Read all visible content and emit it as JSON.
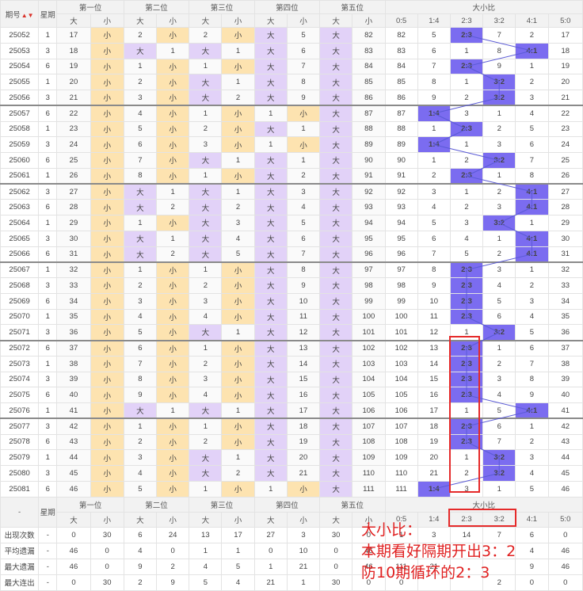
{
  "header": {
    "issue_label": "期号",
    "sort_icon": "▲▼",
    "weekday_label": "星期",
    "positions": [
      "第一位",
      "第二位",
      "第三位",
      "第四位",
      "第五位"
    ],
    "big": "大",
    "small": "小",
    "ratio_title": "大小比",
    "ratios": [
      "0:5",
      "1:4",
      "2:3",
      "3:2",
      "4:1",
      "5:0"
    ]
  },
  "rows": [
    {
      "issue": "25052",
      "wd": "1",
      "p": [
        [
          "17",
          "y"
        ],
        [
          "2",
          "y"
        ],
        [
          "2",
          "y"
        ],
        [
          "大",
          "5"
        ],
        [
          "大",
          "82"
        ]
      ],
      "big": "82",
      "r": [
        "82",
        "5",
        "2:3",
        "7",
        "2",
        "17"
      ],
      "sel": 2
    },
    {
      "issue": "25053",
      "wd": "3",
      "p": [
        [
          "18",
          "y"
        ],
        [
          "大",
          "1"
        ],
        [
          "大",
          "1"
        ],
        [
          "大",
          "6"
        ],
        [
          "大",
          "83"
        ]
      ],
      "big": "83",
      "r": [
        "83",
        "6",
        "1",
        "8",
        "4:1",
        "18"
      ],
      "sel": 4
    },
    {
      "issue": "25054",
      "wd": "6",
      "p": [
        [
          "19",
          "y"
        ],
        [
          "1",
          "y"
        ],
        [
          "1",
          "y"
        ],
        [
          "大",
          "7"
        ],
        [
          "大",
          "84"
        ]
      ],
      "big": "84",
      "r": [
        "84",
        "7",
        "2:3",
        "9",
        "1",
        "19"
      ],
      "sel": 2
    },
    {
      "issue": "25055",
      "wd": "1",
      "p": [
        [
          "20",
          "y"
        ],
        [
          "2",
          "y"
        ],
        [
          "大",
          "1"
        ],
        [
          "大",
          "8"
        ],
        [
          "大",
          "85"
        ]
      ],
      "big": "85",
      "r": [
        "85",
        "8",
        "1",
        "3:2",
        "2",
        "20"
      ],
      "sel": 3
    },
    {
      "issue": "25056",
      "wd": "3",
      "p": [
        [
          "21",
          "y"
        ],
        [
          "3",
          "y"
        ],
        [
          "大",
          "2"
        ],
        [
          "大",
          "9"
        ],
        [
          "大",
          "86"
        ]
      ],
      "big": "86",
      "r": [
        "86",
        "9",
        "2",
        "3:2",
        "3",
        "21"
      ],
      "sel": 3
    },
    {
      "issue": "25057",
      "wd": "6",
      "p": [
        [
          "22",
          "y"
        ],
        [
          "4",
          "y"
        ],
        [
          "1",
          "y"
        ],
        [
          "1",
          "y"
        ],
        [
          "大",
          "87"
        ]
      ],
      "big": "87",
      "r": [
        "87",
        "1:4",
        "3",
        "1",
        "4",
        "22"
      ],
      "sel": 1
    },
    {
      "issue": "25058",
      "wd": "1",
      "p": [
        [
          "23",
          "y"
        ],
        [
          "5",
          "y"
        ],
        [
          "2",
          "y"
        ],
        [
          "大",
          "1"
        ],
        [
          "大",
          "88"
        ]
      ],
      "big": "88",
      "r": [
        "88",
        "1",
        "2:3",
        "2",
        "5",
        "23"
      ],
      "sel": 2
    },
    {
      "issue": "25059",
      "wd": "3",
      "p": [
        [
          "24",
          "y"
        ],
        [
          "6",
          "y"
        ],
        [
          "3",
          "y"
        ],
        [
          "1",
          "y"
        ],
        [
          "大",
          "89"
        ]
      ],
      "big": "89",
      "r": [
        "89",
        "1:4",
        "1",
        "3",
        "6",
        "24"
      ],
      "sel": 1
    },
    {
      "issue": "25060",
      "wd": "6",
      "p": [
        [
          "25",
          "y"
        ],
        [
          "7",
          "y"
        ],
        [
          "大",
          "1"
        ],
        [
          "大",
          "1"
        ],
        [
          "大",
          "90"
        ]
      ],
      "big": "90",
      "r": [
        "90",
        "1",
        "2",
        "3:2",
        "7",
        "25"
      ],
      "sel": 3
    },
    {
      "issue": "25061",
      "wd": "1",
      "p": [
        [
          "26",
          "y"
        ],
        [
          "8",
          "y"
        ],
        [
          "1",
          "y"
        ],
        [
          "大",
          "2"
        ],
        [
          "大",
          "91"
        ]
      ],
      "big": "91",
      "r": [
        "91",
        "2",
        "2:3",
        "1",
        "8",
        "26"
      ],
      "sel": 2
    },
    {
      "issue": "25062",
      "wd": "3",
      "p": [
        [
          "27",
          "y"
        ],
        [
          "大",
          "1"
        ],
        [
          "大",
          "1"
        ],
        [
          "大",
          "3"
        ],
        [
          "大",
          "92"
        ]
      ],
      "big": "92",
      "r": [
        "92",
        "3",
        "1",
        "2",
        "4:1",
        "27"
      ],
      "sel": 4
    },
    {
      "issue": "25063",
      "wd": "6",
      "p": [
        [
          "28",
          "y"
        ],
        [
          "大",
          "2"
        ],
        [
          "大",
          "2"
        ],
        [
          "大",
          "4"
        ],
        [
          "大",
          "93"
        ]
      ],
      "big": "93",
      "r": [
        "93",
        "4",
        "2",
        "3",
        "4:1",
        "28"
      ],
      "sel": 4
    },
    {
      "issue": "25064",
      "wd": "1",
      "p": [
        [
          "29",
          "y"
        ],
        [
          "1",
          "y"
        ],
        [
          "大",
          "3"
        ],
        [
          "大",
          "5"
        ],
        [
          "大",
          "94"
        ]
      ],
      "big": "94",
      "r": [
        "94",
        "5",
        "3",
        "3:2",
        "1",
        "29"
      ],
      "sel": 3
    },
    {
      "issue": "25065",
      "wd": "3",
      "p": [
        [
          "30",
          "y"
        ],
        [
          "大",
          "1"
        ],
        [
          "大",
          "4"
        ],
        [
          "大",
          "6"
        ],
        [
          "大",
          "95"
        ]
      ],
      "big": "95",
      "r": [
        "95",
        "6",
        "4",
        "1",
        "4:1",
        "30"
      ],
      "sel": 4
    },
    {
      "issue": "25066",
      "wd": "6",
      "p": [
        [
          "31",
          "y"
        ],
        [
          "大",
          "2"
        ],
        [
          "大",
          "5"
        ],
        [
          "大",
          "7"
        ],
        [
          "大",
          "96"
        ]
      ],
      "big": "96",
      "r": [
        "96",
        "7",
        "5",
        "2",
        "4:1",
        "31"
      ],
      "sel": 4
    },
    {
      "issue": "25067",
      "wd": "1",
      "p": [
        [
          "32",
          "y"
        ],
        [
          "1",
          "y"
        ],
        [
          "1",
          "y"
        ],
        [
          "大",
          "8"
        ],
        [
          "大",
          "97"
        ]
      ],
      "big": "97",
      "r": [
        "97",
        "8",
        "2:3",
        "3",
        "1",
        "32"
      ],
      "sel": 2
    },
    {
      "issue": "25068",
      "wd": "3",
      "p": [
        [
          "33",
          "y"
        ],
        [
          "2",
          "y"
        ],
        [
          "2",
          "y"
        ],
        [
          "大",
          "9"
        ],
        [
          "大",
          "98"
        ]
      ],
      "big": "98",
      "r": [
        "98",
        "9",
        "2:3",
        "4",
        "2",
        "33"
      ],
      "sel": 2
    },
    {
      "issue": "25069",
      "wd": "6",
      "p": [
        [
          "34",
          "y"
        ],
        [
          "3",
          "y"
        ],
        [
          "3",
          "y"
        ],
        [
          "大",
          "10"
        ],
        [
          "大",
          "99"
        ]
      ],
      "big": "99",
      "r": [
        "99",
        "10",
        "2:3",
        "5",
        "3",
        "34"
      ],
      "sel": 2
    },
    {
      "issue": "25070",
      "wd": "1",
      "p": [
        [
          "35",
          "y"
        ],
        [
          "4",
          "y"
        ],
        [
          "4",
          "y"
        ],
        [
          "大",
          "11"
        ],
        [
          "大",
          "100"
        ]
      ],
      "big": "100",
      "r": [
        "100",
        "11",
        "2:3",
        "6",
        "4",
        "35"
      ],
      "sel": 2
    },
    {
      "issue": "25071",
      "wd": "3",
      "p": [
        [
          "36",
          "y"
        ],
        [
          "5",
          "y"
        ],
        [
          "大",
          "1"
        ],
        [
          "大",
          "12"
        ],
        [
          "大",
          "101"
        ]
      ],
      "big": "101",
      "r": [
        "101",
        "12",
        "1",
        "3:2",
        "5",
        "36"
      ],
      "sel": 3
    },
    {
      "issue": "25072",
      "wd": "6",
      "p": [
        [
          "37",
          "y"
        ],
        [
          "6",
          "y"
        ],
        [
          "1",
          "y"
        ],
        [
          "大",
          "13"
        ],
        [
          "大",
          "102"
        ]
      ],
      "big": "102",
      "r": [
        "102",
        "13",
        "2:3",
        "1",
        "6",
        "37"
      ],
      "sel": 2
    },
    {
      "issue": "25073",
      "wd": "1",
      "p": [
        [
          "38",
          "y"
        ],
        [
          "7",
          "y"
        ],
        [
          "2",
          "y"
        ],
        [
          "大",
          "14"
        ],
        [
          "大",
          "103"
        ]
      ],
      "big": "103",
      "r": [
        "103",
        "14",
        "2:3",
        "2",
        "7",
        "38"
      ],
      "sel": 2
    },
    {
      "issue": "25074",
      "wd": "3",
      "p": [
        [
          "39",
          "y"
        ],
        [
          "8",
          "y"
        ],
        [
          "3",
          "y"
        ],
        [
          "大",
          "15"
        ],
        [
          "大",
          "104"
        ]
      ],
      "big": "104",
      "r": [
        "104",
        "15",
        "2:3",
        "3",
        "8",
        "39"
      ],
      "sel": 2
    },
    {
      "issue": "25075",
      "wd": "6",
      "p": [
        [
          "40",
          "y"
        ],
        [
          "9",
          "y"
        ],
        [
          "4",
          "y"
        ],
        [
          "大",
          "16"
        ],
        [
          "大",
          "105"
        ]
      ],
      "big": "105",
      "r": [
        "105",
        "16",
        "2:3",
        "4",
        "9",
        "40"
      ],
      "sel": 2
    },
    {
      "issue": "25076",
      "wd": "1",
      "p": [
        [
          "41",
          "y"
        ],
        [
          "大",
          "1"
        ],
        [
          "大",
          "1"
        ],
        [
          "大",
          "17"
        ],
        [
          "大",
          "106"
        ]
      ],
      "big": "106",
      "r": [
        "106",
        "17",
        "1",
        "5",
        "4:1",
        "41"
      ],
      "sel": 4
    },
    {
      "issue": "25077",
      "wd": "3",
      "p": [
        [
          "42",
          "y"
        ],
        [
          "1",
          "y"
        ],
        [
          "1",
          "y"
        ],
        [
          "大",
          "18"
        ],
        [
          "大",
          "107"
        ]
      ],
      "big": "107",
      "r": [
        "107",
        "18",
        "2:3",
        "6",
        "1",
        "42"
      ],
      "sel": 2
    },
    {
      "issue": "25078",
      "wd": "6",
      "p": [
        [
          "43",
          "y"
        ],
        [
          "2",
          "y"
        ],
        [
          "2",
          "y"
        ],
        [
          "大",
          "19"
        ],
        [
          "大",
          "108"
        ]
      ],
      "big": "108",
      "r": [
        "108",
        "19",
        "2:3",
        "7",
        "2",
        "43"
      ],
      "sel": 2
    },
    {
      "issue": "25079",
      "wd": "1",
      "p": [
        [
          "44",
          "y"
        ],
        [
          "3",
          "y"
        ],
        [
          "大",
          "1"
        ],
        [
          "大",
          "20"
        ],
        [
          "大",
          "109"
        ]
      ],
      "big": "109",
      "r": [
        "109",
        "20",
        "1",
        "3:2",
        "3",
        "44"
      ],
      "sel": 3
    },
    {
      "issue": "25080",
      "wd": "3",
      "p": [
        [
          "45",
          "y"
        ],
        [
          "4",
          "y"
        ],
        [
          "大",
          "2"
        ],
        [
          "大",
          "21"
        ],
        [
          "大",
          "110"
        ]
      ],
      "big": "110",
      "r": [
        "110",
        "21",
        "2",
        "3:2",
        "4",
        "45"
      ],
      "sel": 3
    },
    {
      "issue": "25081",
      "wd": "6",
      "p": [
        [
          "46",
          "y"
        ],
        [
          "5",
          "y"
        ],
        [
          "1",
          "y"
        ],
        [
          "1",
          "y"
        ],
        [
          "大",
          "111"
        ]
      ],
      "big": "111",
      "r": [
        "111",
        "1:4",
        "3",
        "1",
        "5",
        "46"
      ],
      "sel": 1
    }
  ],
  "footer": {
    "dash": "-",
    "weekday_label": "星期",
    "stats": [
      {
        "label": "出现次数",
        "wd": "-",
        "vals": [
          "0",
          "30",
          "6",
          "24",
          "13",
          "17",
          "27",
          "3",
          "30",
          "0",
          "1",
          "3",
          "14",
          "7",
          "6",
          "0"
        ]
      },
      {
        "label": "平均遗漏",
        "wd": "-",
        "vals": [
          "46",
          "0",
          "4",
          "0",
          "1",
          "1",
          "0",
          "10",
          "0",
          "46",
          "",
          "",
          "",
          "",
          "4",
          "46"
        ]
      },
      {
        "label": "最大遗漏",
        "wd": "-",
        "vals": [
          "46",
          "0",
          "9",
          "2",
          "4",
          "5",
          "1",
          "21",
          "0",
          "46",
          "111",
          "21",
          "",
          "",
          "9",
          "46"
        ]
      },
      {
        "label": "最大连出",
        "wd": "-",
        "vals": [
          "0",
          "30",
          "2",
          "9",
          "5",
          "4",
          "21",
          "1",
          "30",
          "0",
          "0",
          "",
          "",
          "2",
          "0",
          "0"
        ]
      }
    ]
  },
  "annotation": {
    "line1": "大小比：",
    "line2": "本期看好隔期开出3：2",
    "line3": "防10期循环的2：3"
  },
  "colors": {
    "small_bg": "#fde3b0",
    "big_bg": "#e2d2f8",
    "selected": "#7b6cf0",
    "note": "#e02020"
  }
}
